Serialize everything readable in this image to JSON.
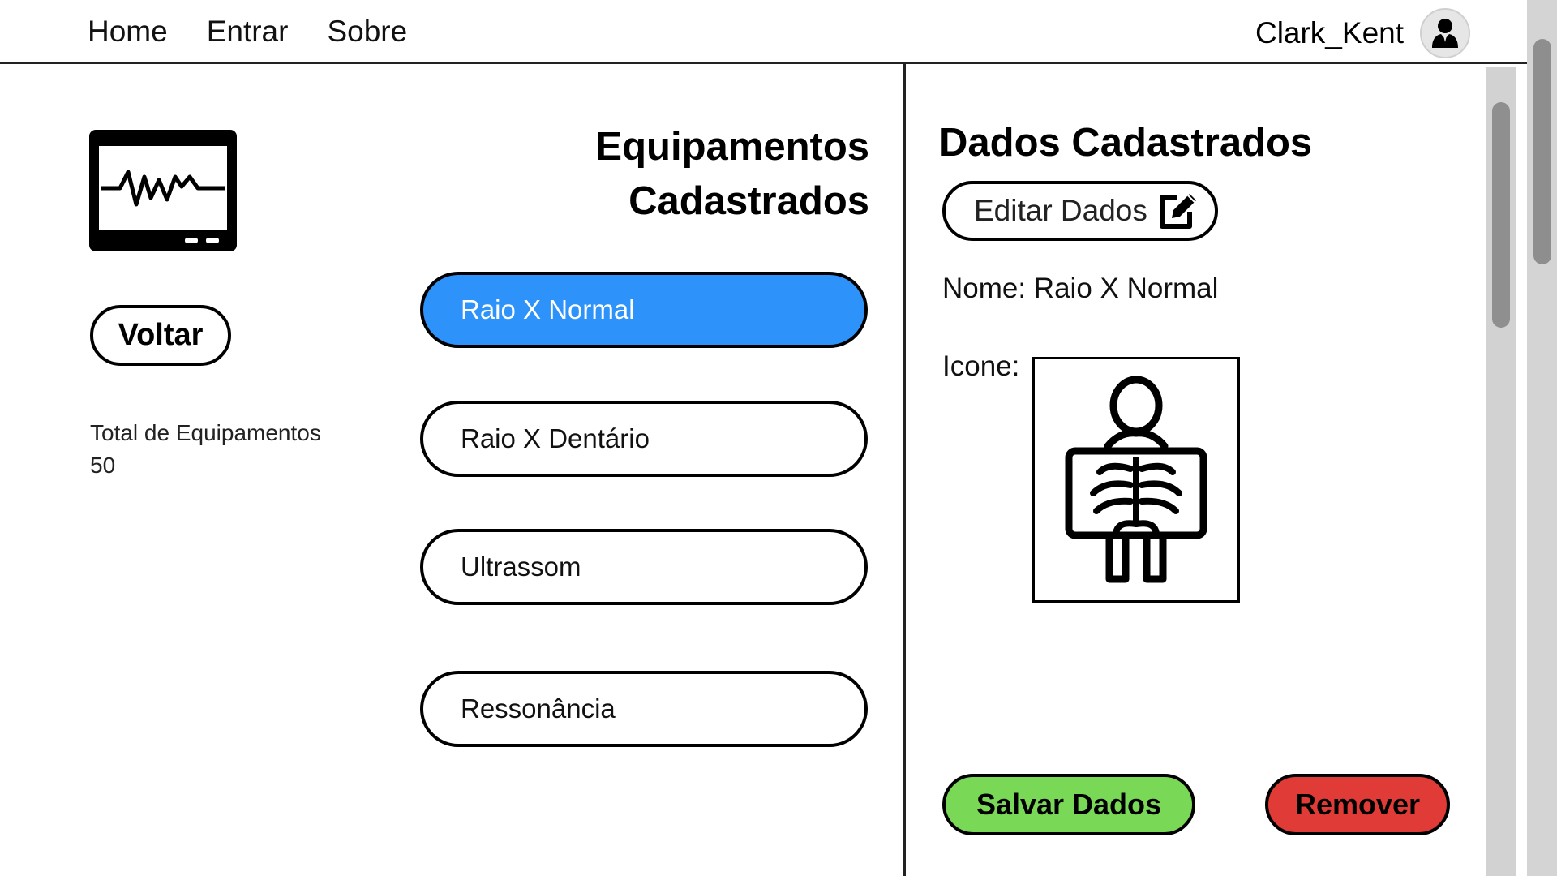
{
  "nav": {
    "items": [
      "Home",
      "Entrar",
      "Sobre"
    ]
  },
  "user": {
    "name": "Clark_Kent",
    "avatar_icon": "user-icon"
  },
  "left": {
    "equipment_icon": "heart-monitor-icon",
    "back_label": "Voltar",
    "total_label": "Total de Equipamentos",
    "total_value": "50"
  },
  "list": {
    "title_line1": "Equipamentos",
    "title_line2": "Cadastrados",
    "items": [
      {
        "label": "Raio X Normal",
        "selected": true
      },
      {
        "label": "Raio X Dentário",
        "selected": false
      },
      {
        "label": "Ultrassom",
        "selected": false
      },
      {
        "label": "Ressonância",
        "selected": false
      }
    ]
  },
  "detail": {
    "title": "Dados Cadastrados",
    "edit_label": "Editar Dados",
    "edit_icon": "edit-icon",
    "name_row": "Nome: Raio X Normal",
    "icon_label": "Icone:",
    "icon_preview": "xray-icon",
    "save_label": "Salvar Dados",
    "remove_label": "Remover"
  },
  "colors": {
    "selected_item": "#2d93fb",
    "save_button": "#79d957",
    "remove_button": "#e03b36"
  }
}
